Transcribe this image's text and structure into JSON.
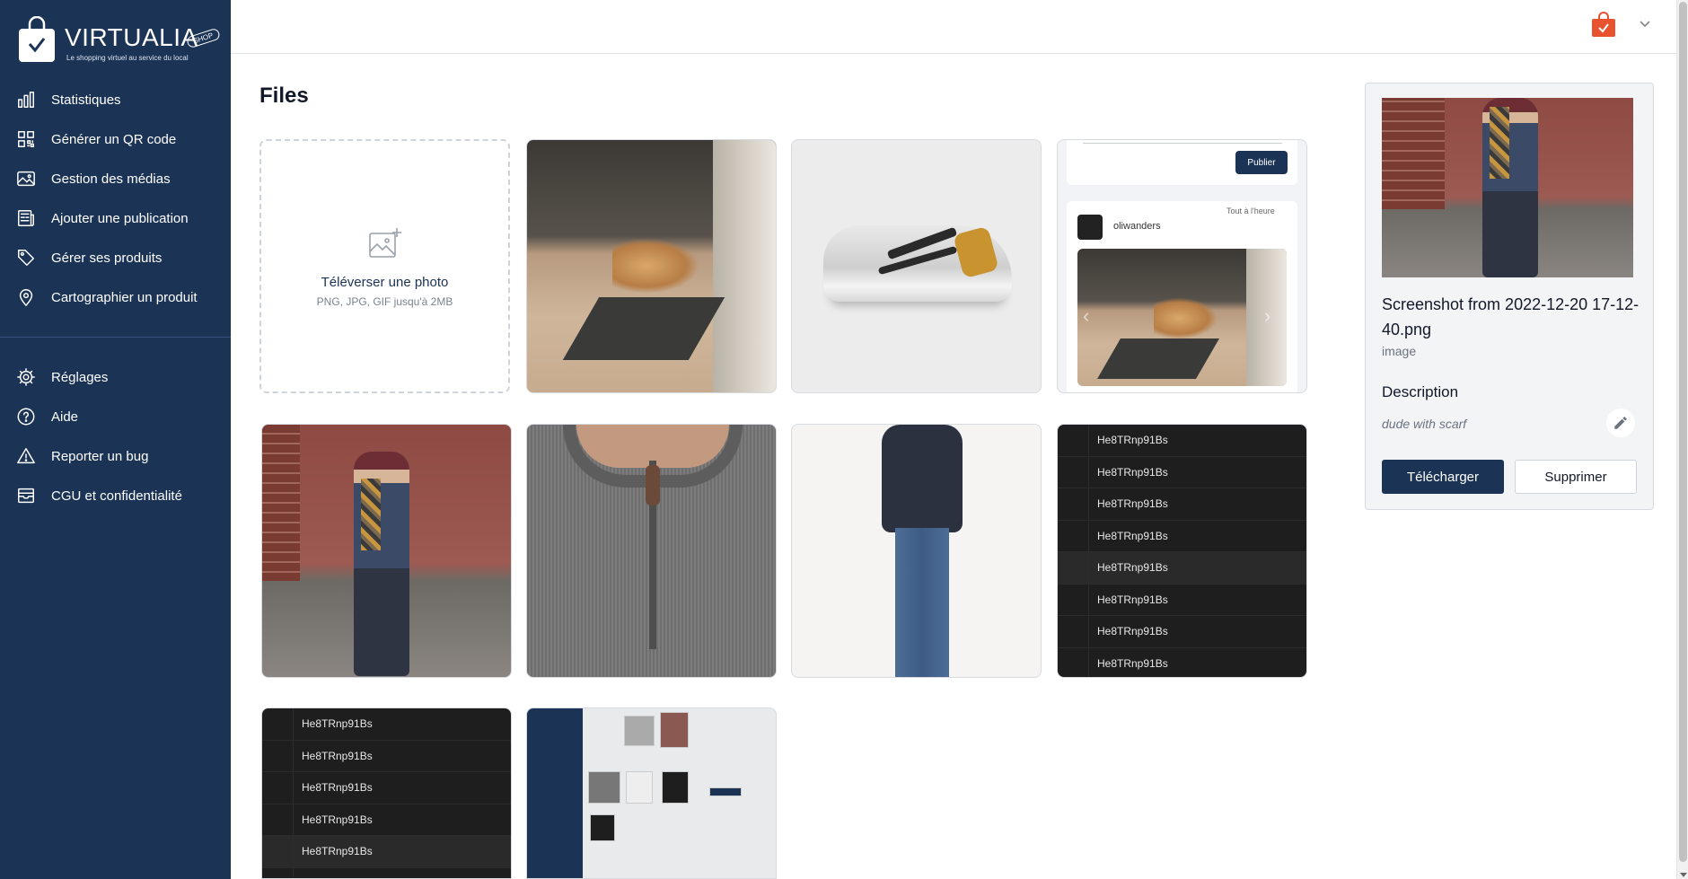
{
  "brand": {
    "name": "VIRTUALIA",
    "tagline": "Le shopping virtuel au service du local",
    "shop_tag": "SHOP",
    "accent": "#1b3355",
    "cart_color": "#e8522f"
  },
  "sidebar": {
    "items": [
      {
        "label": "Statistiques",
        "icon": "chart-bar-icon"
      },
      {
        "label": "Générer un QR code",
        "icon": "qr-code-icon"
      },
      {
        "label": "Gestion des médias",
        "icon": "image-icon"
      },
      {
        "label": "Ajouter une publication",
        "icon": "newspaper-icon"
      },
      {
        "label": "Gérer ses produits",
        "icon": "tag-icon"
      },
      {
        "label": "Cartographier un produit",
        "icon": "map-pin-icon"
      }
    ],
    "bottom_items": [
      {
        "label": "Réglages",
        "icon": "gear-icon"
      },
      {
        "label": "Aide",
        "icon": "help-circle-icon"
      },
      {
        "label": "Reporter un bug",
        "icon": "warning-icon"
      },
      {
        "label": "CGU et confidentialité",
        "icon": "archive-icon"
      }
    ]
  },
  "main": {
    "title": "Files",
    "upload": {
      "title": "Téléverser une photo",
      "subtitle": "PNG, JPG, GIF jusqu'à 2MB"
    },
    "feed_preview": {
      "publish_label": "Publier",
      "username": "oliwanders",
      "time": "Tout à l'heure"
    },
    "list_text": "He8TRnp91Bs"
  },
  "details": {
    "file_name": "Screenshot from 2022-12-20 17-12-40.png",
    "file_type": "image",
    "description_heading": "Description",
    "description": "dude with scarf",
    "download_label": "Télécharger",
    "delete_label": "Supprimer"
  }
}
